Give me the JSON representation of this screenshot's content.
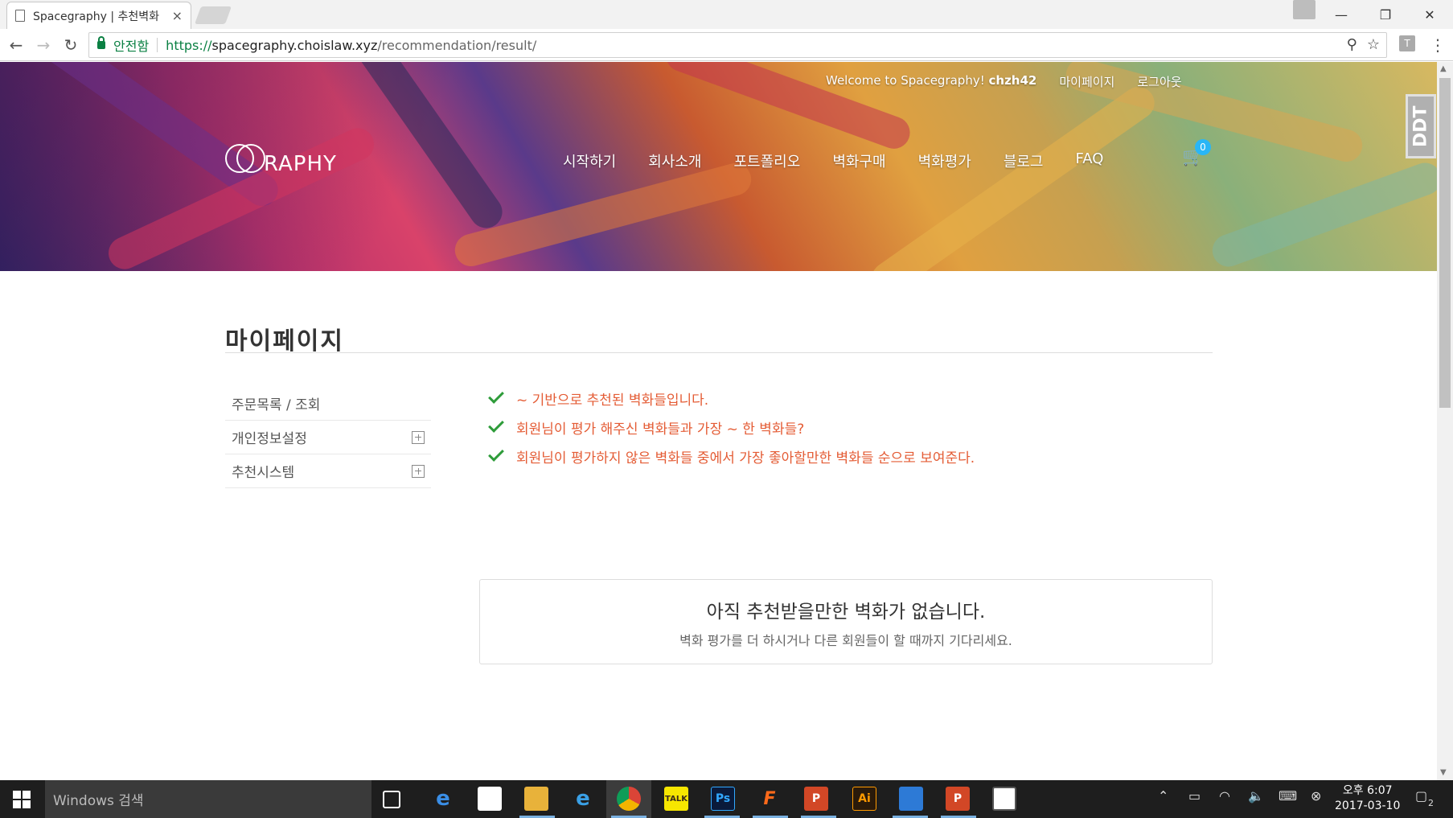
{
  "browser": {
    "tab_title": "Spacegraphy | 추천벽화",
    "tab_close": "×",
    "secure_label": "안전함",
    "url_scheme": "https://",
    "url_host": "spacegraphy.choislaw.xyz",
    "url_path": "/recommendation/result/",
    "ext_label": "T"
  },
  "site": {
    "welcome_text": "Welcome to Spacegraphy!",
    "username": "chzh42",
    "mypage_link": "마이페이지",
    "logout_link": "로그아웃",
    "logo_word": "RAPHY",
    "nav": [
      "시작하기",
      "회사소개",
      "포트폴리오",
      "벽화구매",
      "벽화평가",
      "블로그",
      "FAQ"
    ],
    "cart_count": "0",
    "ddt_label": "DDT"
  },
  "page": {
    "title": "마이페이지",
    "sidebar": [
      "주문목록 / 조회",
      "개인정보설정",
      "추천시스템"
    ],
    "notes": [
      "~ 기반으로 추천된 벽화들입니다.",
      "회원님이 평가 해주신 벽화들과 가장 ~ 한 벽화들?",
      "회원님이 평가하지 않은 벽화들 중에서 가장 좋아할만한 벽화들 순으로 보여준다."
    ],
    "empty_title": "아직 추천받을만한 벽화가 없습니다.",
    "empty_sub": "벽화 평가를 더 하시거나 다른 회원들이 할 때까지 기다리세요."
  },
  "taskbar": {
    "search_placeholder": "Windows 검색",
    "clock_time": "오후 6:07",
    "clock_date": "2017-03-10",
    "notification_count": "2"
  },
  "colors": {
    "accent_note": "#e45c35",
    "check": "#2e9c3a",
    "badge": "#29b6f6",
    "secure": "#0b8043"
  }
}
